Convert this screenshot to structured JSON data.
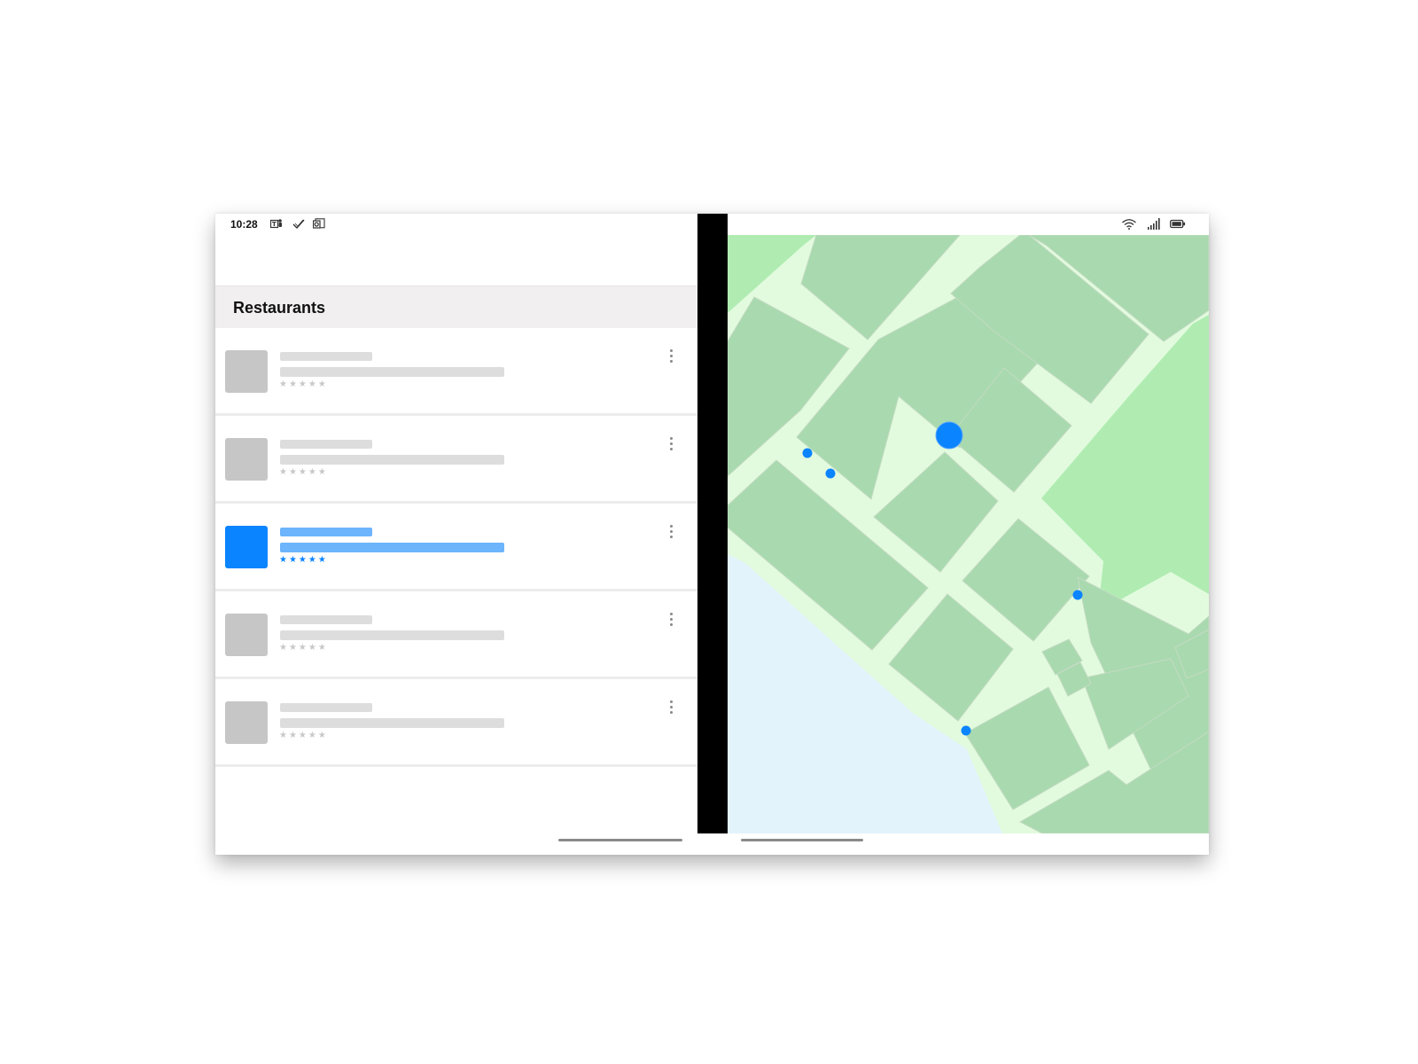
{
  "status_bar": {
    "time": "10:28",
    "left_icons": [
      "teams-icon",
      "todo-check-icon",
      "outlook-icon"
    ],
    "right_icons": [
      "wifi-icon",
      "cellular-signal-icon",
      "battery-icon"
    ]
  },
  "list_pane": {
    "title": "Restaurants",
    "items": [
      {
        "selected": false,
        "rating_stars": "★★★★★"
      },
      {
        "selected": false,
        "rating_stars": "★★★★★"
      },
      {
        "selected": true,
        "rating_stars": "★★★★★"
      },
      {
        "selected": false,
        "rating_stars": "★★★★★"
      },
      {
        "selected": false,
        "rating_stars": "★★★★★"
      }
    ]
  },
  "map": {
    "pins": [
      "restaurant-pin",
      "restaurant-pin",
      "restaurant-pin",
      "restaurant-pin"
    ],
    "selected_pin": "selected-restaurant-pin"
  },
  "colors": {
    "accent": "#0a84ff",
    "accent_light": "#6cb4fb",
    "placeholder": "#dddddd",
    "thumbnail_placeholder": "#c6c6c6",
    "map_block": "#a9d9ae",
    "map_park": "#b0ecb2",
    "map_road": "#e2fbde",
    "map_water": "#e3f3fc",
    "hinge": "#000000",
    "section_header_bg": "#f1efef"
  }
}
